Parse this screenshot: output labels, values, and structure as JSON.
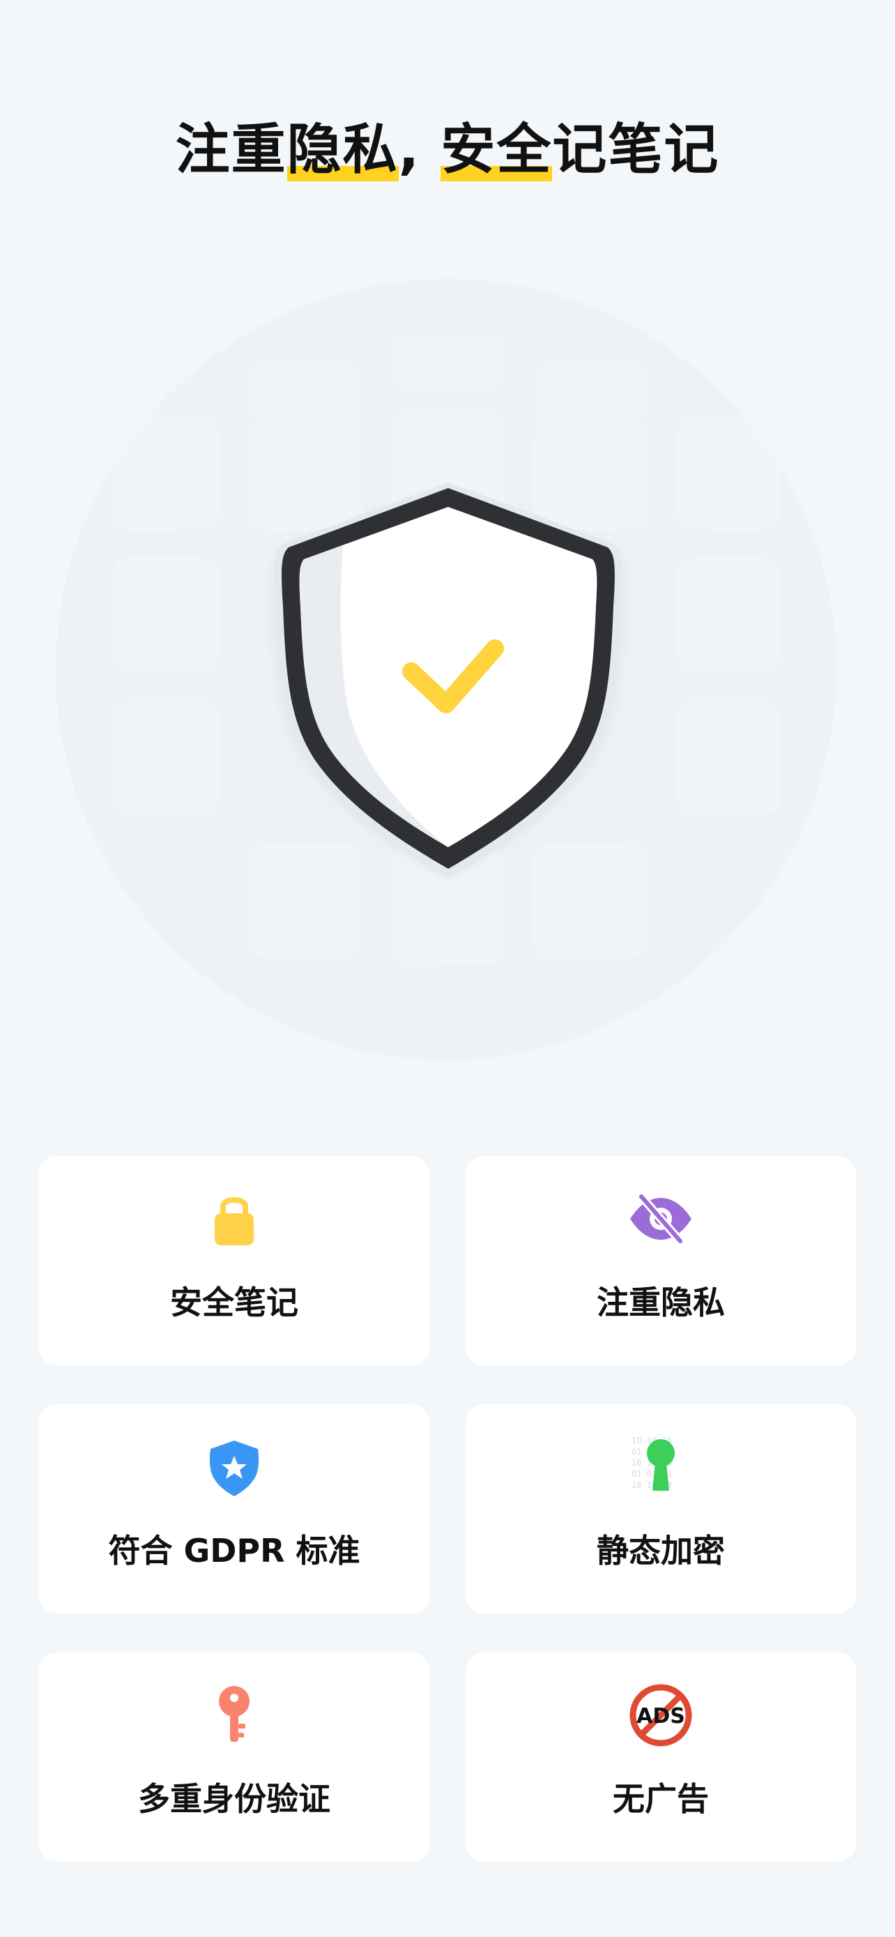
{
  "header": {
    "title_part1": "注重",
    "title_hl1": "隐私",
    "title_part2": ", ",
    "title_hl2": "安全",
    "title_part3": "记笔记",
    "highlight_color": "#ffd21f"
  },
  "hero": {
    "icon": "shield-check-icon",
    "check_color": "#ffd33d"
  },
  "features": [
    {
      "label": "安全笔记",
      "icon": "lock-icon",
      "color": "#ffd24a"
    },
    {
      "label": "注重隐私",
      "icon": "eye-slash-icon",
      "color": "#9b6bd8"
    },
    {
      "label": "符合 GDPR 标准",
      "icon": "shield-star-icon",
      "color": "#3a96f5"
    },
    {
      "label": "静态加密",
      "icon": "keyhole-binary-icon",
      "color": "#3ecf5a"
    },
    {
      "label": "多重身份验证",
      "icon": "key-icon",
      "color": "#f9836f"
    },
    {
      "label": "无广告",
      "icon": "no-ads-icon",
      "color": "#e04a32",
      "icon_text": "ADS"
    }
  ]
}
